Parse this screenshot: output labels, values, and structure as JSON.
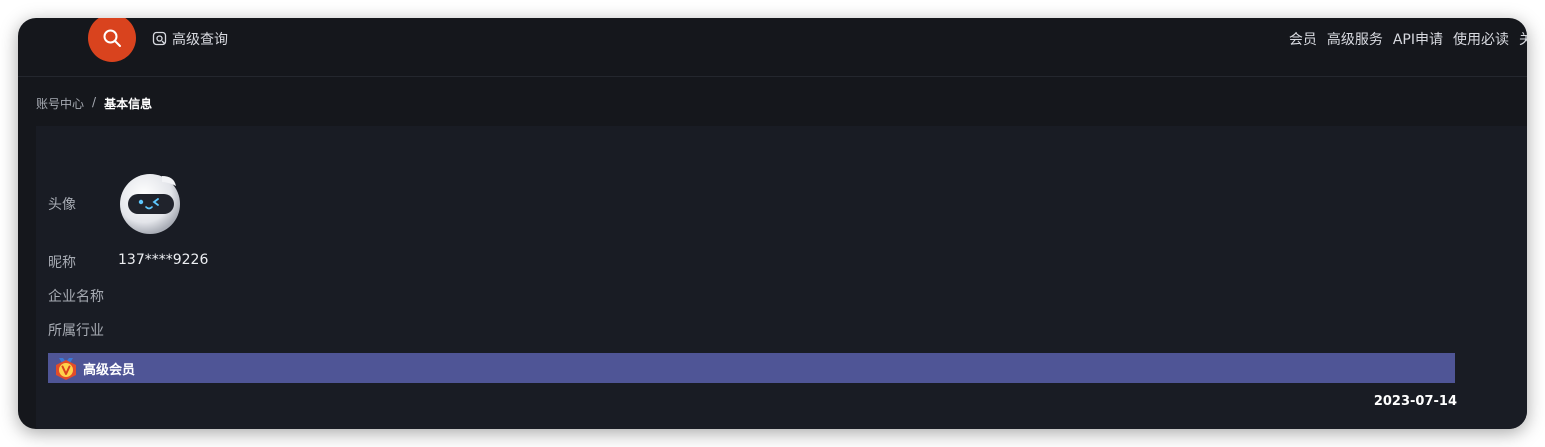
{
  "topbar": {
    "search_icon": "search-icon",
    "advanced_query_icon": "at-search-icon",
    "advanced_query_label": "高级查询",
    "nav": [
      "会员",
      "高级服务",
      "API申请",
      "使用必读",
      "关"
    ]
  },
  "breadcrumb": {
    "parent": "账号中心",
    "separator": "/",
    "current": "基本信息"
  },
  "profile": {
    "avatar_label": "头像",
    "nickname_label": "昵称",
    "nickname_value": "137****9226",
    "company_label": "企业名称",
    "company_value": "",
    "industry_label": "所属行业",
    "industry_value": ""
  },
  "membership": {
    "badge_icon": "vip-badge-icon",
    "title": "高级会员",
    "date": "2023-07-14",
    "bar_color": "#4f5596"
  },
  "colors": {
    "accent": "#d9431e",
    "background": "#15171c",
    "panel": "#191c24"
  }
}
